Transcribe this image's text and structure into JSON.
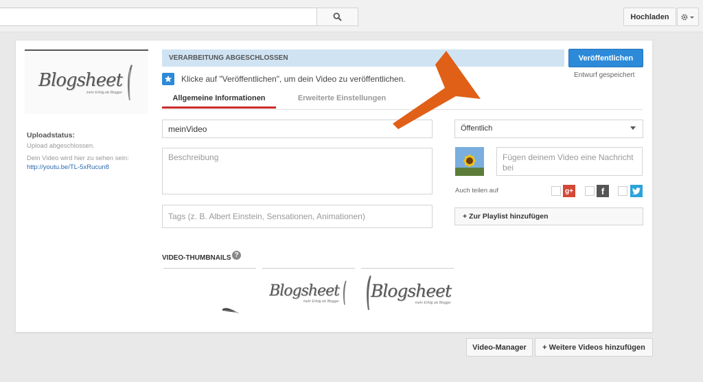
{
  "header": {
    "search_icon": "search-icon",
    "upload_label": "Hochladen",
    "settings_icon": "gear-icon"
  },
  "sidebar": {
    "logo_text": "Blogsheet",
    "logo_tagline": "mehr Erfolg als Blogger",
    "upload_status_title": "Uploadstatus:",
    "upload_status_text": "Upload abgeschlossen.",
    "link_label": "Dein Video wird hier zu sehen sein:",
    "link": "http://youtu.be/TL-5xRucun8"
  },
  "status": {
    "banner": "VERARBEITUNG ABGESCHLOSSEN",
    "publish_label": "Veröffentlichen",
    "draft_saved": "Entwurf gespeichert",
    "hint": "Klicke auf \"Veröffentlichen\", um dein Video zu veröffentlichen."
  },
  "tabs": [
    {
      "label": "Allgemeine Informationen"
    },
    {
      "label": "Erweiterte Einstellungen"
    }
  ],
  "form": {
    "title_value": "meinVideo",
    "description_placeholder": "Beschreibung",
    "tags_placeholder": "Tags (z. B. Albert Einstein, Sensationen, Animationen)",
    "privacy_value": "Öffentlich",
    "message_placeholder": "Fügen deinem Video eine Nachricht bei",
    "share_label": "Auch teilen auf",
    "playlist_label": "+ Zur Playlist hinzufügen",
    "thumbnails_title": "VIDEO-THUMBNAILS"
  },
  "footer": {
    "video_manager_label": "Video-Manager",
    "more_videos_label": "+ Weitere Videos hinzufügen"
  },
  "colors": {
    "accent": "#2d8ad8",
    "banner": "#cfe3f3",
    "tab_active": "#cc2929",
    "arrow": "#e06018"
  }
}
